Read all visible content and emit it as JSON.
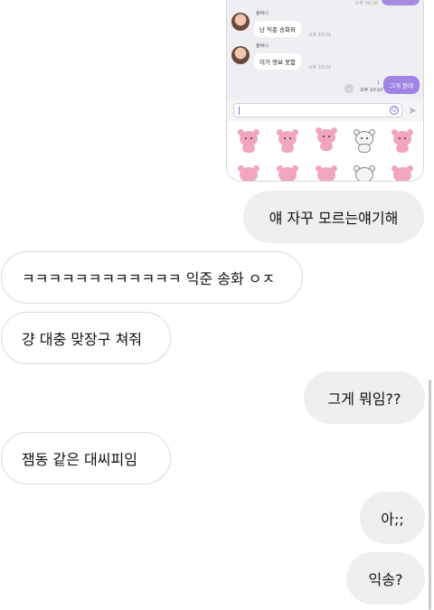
{
  "embedded_chat": {
    "cut_time": "오후 09:36",
    "messages": [
      {
        "sender": "율써니",
        "text": "난 익준 송화파",
        "time": "오후 10:01"
      },
      {
        "sender": "율써니",
        "text": "이거 영보 못함",
        "time": "오후 10:02"
      }
    ],
    "my_message": {
      "text": "그게 뭔데",
      "read_count": "1",
      "time": "오후 10:10"
    },
    "input_placeholder": ""
  },
  "messages": [
    {
      "side": "out",
      "text": "얘 자꾸 모르는얘기해"
    },
    {
      "side": "in",
      "text": "ㅋㅋㅋㅋㅋㅋㅋㅋㅋㅋㅋㅋ 익준 송화 ㅇㅈ"
    },
    {
      "side": "in",
      "text": "걍 대충 맞장구 쳐줘"
    },
    {
      "side": "out",
      "text": "그게 뭐임??"
    },
    {
      "side": "in",
      "text": "잼동 같은 대씨피임"
    },
    {
      "side": "out",
      "text": "아;;"
    },
    {
      "side": "out",
      "text": "익송?"
    }
  ]
}
